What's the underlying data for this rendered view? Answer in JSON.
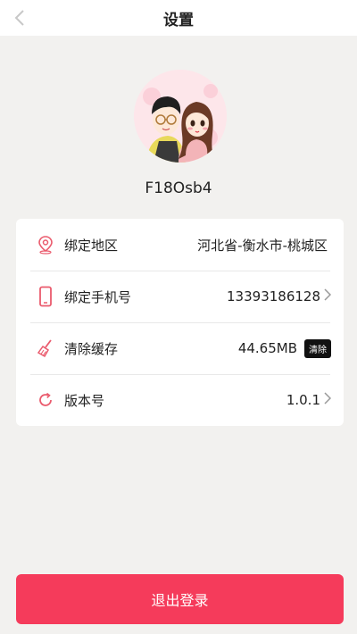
{
  "header": {
    "title": "设置"
  },
  "profile": {
    "username": "F18Osb4"
  },
  "settings": {
    "items": [
      {
        "icon": "location-pin-icon",
        "label": "绑定地区",
        "value": "河北省-衡水市-桃城区"
      },
      {
        "icon": "phone-icon",
        "label": "绑定手机号",
        "value": "13393186128"
      },
      {
        "icon": "broom-icon",
        "label": "清除缓存",
        "value": "44.65MB",
        "action": "清除"
      },
      {
        "icon": "refresh-icon",
        "label": "版本号",
        "value": "1.0.1"
      }
    ]
  },
  "footer": {
    "logout_label": "退出登录"
  },
  "colors": {
    "accent": "#f53b5b",
    "background": "#f2f1ef",
    "icon": "#ea5b6d"
  }
}
